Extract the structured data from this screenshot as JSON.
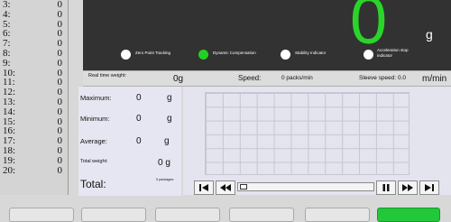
{
  "index_rows": [
    {
      "label": "3:",
      "value": "0"
    },
    {
      "label": "4:",
      "value": "0"
    },
    {
      "label": "5:",
      "value": "0"
    },
    {
      "label": "6:",
      "value": "0"
    },
    {
      "label": "7:",
      "value": "0"
    },
    {
      "label": "8:",
      "value": "0"
    },
    {
      "label": "9:",
      "value": "0"
    },
    {
      "label": "10:",
      "value": "0"
    },
    {
      "label": "11:",
      "value": "0"
    },
    {
      "label": "12:",
      "value": "0"
    },
    {
      "label": "13:",
      "value": "0"
    },
    {
      "label": "14:",
      "value": "0"
    },
    {
      "label": "15:",
      "value": "0"
    },
    {
      "label": "16:",
      "value": "0"
    },
    {
      "label": "17:",
      "value": "0"
    },
    {
      "label": "18:",
      "value": "0"
    },
    {
      "label": "19:",
      "value": "0"
    },
    {
      "label": "20:",
      "value": "0"
    }
  ],
  "display": {
    "weight": "0",
    "unit": "g",
    "accent_color": "#2ad42a",
    "indicators": [
      {
        "label": "Zero Point Tracking",
        "active": false
      },
      {
        "label": "Dynamic Compensation",
        "active": true
      },
      {
        "label": "Stability Indicator",
        "active": false
      },
      {
        "label": "Acceleration stop indicator",
        "active": false
      }
    ]
  },
  "status": {
    "realtime_label": "Real time weight:",
    "realtime_value": "0g",
    "speed_label": "Speed:",
    "speed_value": "0 packs/min",
    "sleeve_label": "Sleeve speed: 0.0",
    "sleeve_unit": "m/min"
  },
  "stats": {
    "maximum_label": "Maximum:",
    "maximum_value": "0",
    "maximum_unit": "g",
    "minimum_label": "Minimum:",
    "minimum_value": "0",
    "minimum_unit": "g",
    "average_label": "Average:",
    "average_value": "0",
    "average_unit": "g",
    "total_weight_label": "Total weight:",
    "total_weight_value": "0 g",
    "total_label": "Total:",
    "total_value": "0 packages"
  },
  "controls": [
    {
      "name": "skip-to-start-icon"
    },
    {
      "name": "rewind-icon"
    },
    {
      "name": "pause-icon"
    },
    {
      "name": "fast-forward-icon"
    },
    {
      "name": "skip-to-end-icon"
    }
  ]
}
